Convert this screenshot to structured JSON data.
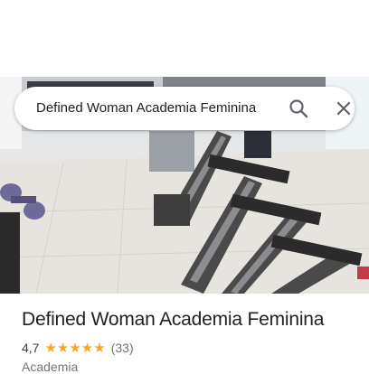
{
  "search": {
    "query": "Defined Woman Academia Feminina",
    "search_icon": "search-icon",
    "close_icon": "close-icon"
  },
  "place": {
    "name": "Defined Woman Academia Feminina",
    "rating": "4,7",
    "stars": "★★★★★",
    "rating_fraction": 0.94,
    "review_count": "(33)",
    "category": "Academia"
  },
  "photo": {
    "subject": "gym-photo"
  },
  "colors": {
    "star": "#f5a623",
    "text_primary": "#202124",
    "text_secondary": "#70757a"
  }
}
